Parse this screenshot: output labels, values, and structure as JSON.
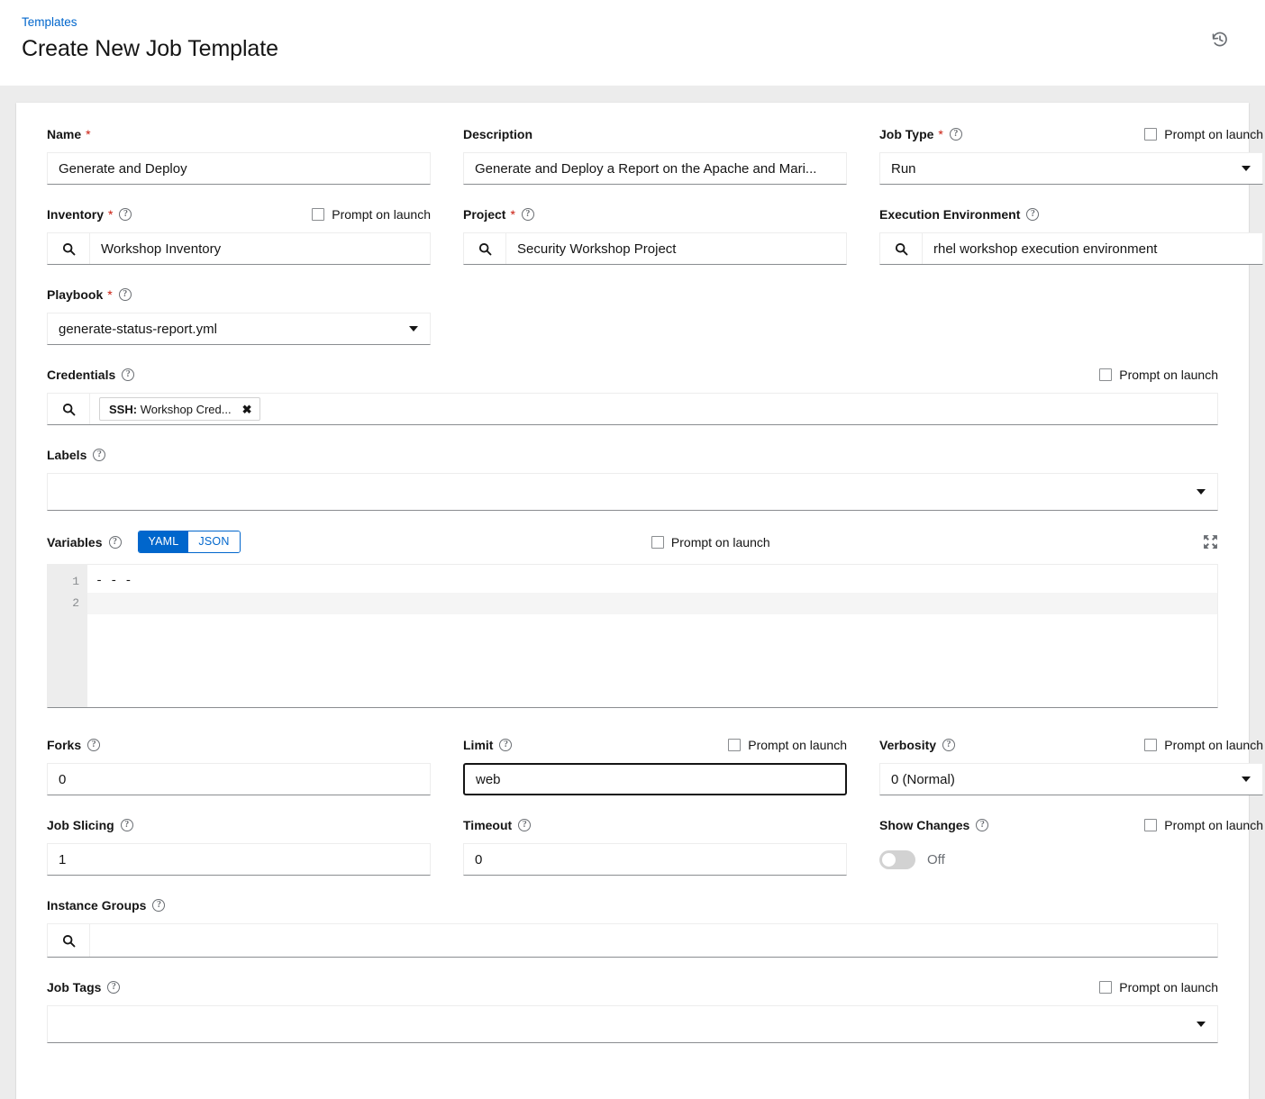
{
  "header": {
    "breadcrumb": "Templates",
    "title": "Create New Job Template",
    "history_icon": "history-icon"
  },
  "form": {
    "name": {
      "label": "Name",
      "required": "*",
      "value": "Generate and Deploy"
    },
    "description": {
      "label": "Description",
      "value": "Generate and Deploy a Report on the Apache and Mari..."
    },
    "job_type": {
      "label": "Job Type",
      "required": "*",
      "value": "Run",
      "prompt_label": "Prompt on launch"
    },
    "inventory": {
      "label": "Inventory",
      "required": "*",
      "value": "Workshop Inventory",
      "prompt_label": "Prompt on launch"
    },
    "project": {
      "label": "Project",
      "required": "*",
      "value": "Security Workshop Project"
    },
    "execution_environment": {
      "label": "Execution Environment",
      "value": "rhel workshop execution environment"
    },
    "playbook": {
      "label": "Playbook",
      "required": "*",
      "value": "generate-status-report.yml"
    },
    "credentials": {
      "label": "Credentials",
      "chip_prefix": "SSH:",
      "chip_text": "Workshop Cred...",
      "prompt_label": "Prompt on launch"
    },
    "labels": {
      "label": "Labels",
      "value": ""
    },
    "variables": {
      "label": "Variables",
      "modes": [
        "YAML",
        "JSON"
      ],
      "selected_mode": "YAML",
      "prompt_label": "Prompt on launch",
      "lines": [
        {
          "number": "1",
          "text": "- - -",
          "active": false
        },
        {
          "number": "2",
          "text": "",
          "active": true
        }
      ]
    },
    "forks": {
      "label": "Forks",
      "value": "0"
    },
    "limit": {
      "label": "Limit",
      "value": "web",
      "prompt_label": "Prompt on launch"
    },
    "verbosity": {
      "label": "Verbosity",
      "value": "0 (Normal)",
      "prompt_label": "Prompt on launch"
    },
    "job_slicing": {
      "label": "Job Slicing",
      "value": "1"
    },
    "timeout": {
      "label": "Timeout",
      "value": "0"
    },
    "show_changes": {
      "label": "Show Changes",
      "state_label": "Off",
      "prompt_label": "Prompt on launch"
    },
    "instance_groups": {
      "label": "Instance Groups",
      "value": ""
    },
    "job_tags": {
      "label": "Job Tags",
      "value": "",
      "prompt_label": "Prompt on launch"
    }
  },
  "colors": {
    "link": "#06c",
    "required": "#c9190b",
    "accent": "#06c",
    "page_bg": "#ececec",
    "card_bg": "#ffffff"
  }
}
